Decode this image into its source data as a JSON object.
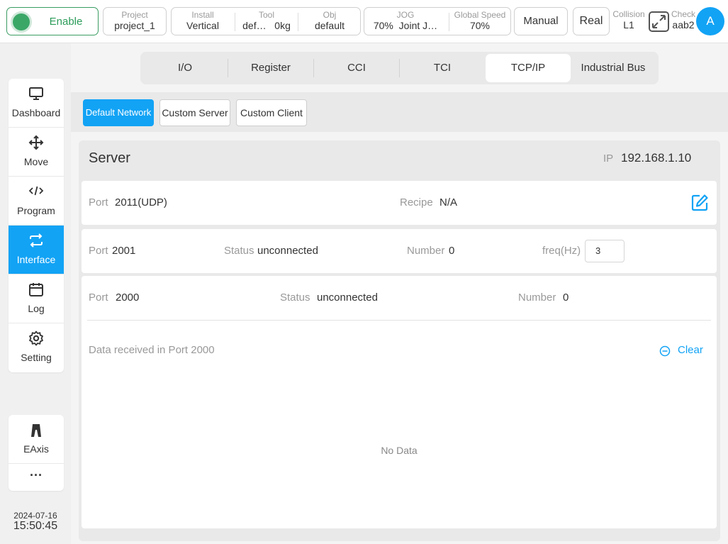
{
  "topbar": {
    "enable_label": "Enable",
    "project": {
      "caption": "Project",
      "value": "project_1"
    },
    "install": {
      "caption": "Install",
      "value": "Vertical"
    },
    "tool": {
      "caption": "Tool",
      "name": "def…",
      "weight": "0kg"
    },
    "obj": {
      "caption": "Obj",
      "value": "default"
    },
    "jog": {
      "caption": "JOG",
      "percent": "70%",
      "mode": "Joint J…"
    },
    "global_speed": {
      "caption": "Global Speed",
      "value": "70%"
    },
    "manual_label": "Manual",
    "real_label": "Real",
    "collision": {
      "caption": "Collision",
      "value": "L1"
    },
    "check": {
      "caption": "Check",
      "value": "aab2"
    },
    "avatar_letter": "A",
    "colors": {
      "accent": "#12a3f5",
      "enable_green": "#3aa767"
    }
  },
  "sidebar": {
    "items": [
      {
        "label": "Dashboard",
        "icon": "monitor-icon"
      },
      {
        "label": "Move",
        "icon": "move-arrows-icon"
      },
      {
        "label": "Program",
        "icon": "code-icon"
      },
      {
        "label": "Interface",
        "icon": "swap-icon",
        "active": true
      },
      {
        "label": "Log",
        "icon": "calendar-icon"
      },
      {
        "label": "Setting",
        "icon": "gear-icon"
      }
    ],
    "extra": {
      "label": "EAxis",
      "icon": "eaxis-icon"
    },
    "more": "···",
    "date": "2024-07-16",
    "time": "15:50:45"
  },
  "tabs": [
    "I/O",
    "Register",
    "CCI",
    "TCI",
    "TCP/IP",
    "Industrial Bus"
  ],
  "active_tab": "TCP/IP",
  "subtabs": [
    "Default Network",
    "Custom Server",
    "Custom Client"
  ],
  "active_subtab": "Default Network",
  "server": {
    "title": "Server",
    "ip_label": "IP",
    "ip_value": "192.168.1.10",
    "row1": {
      "port_label": "Port",
      "port_value": "2011(UDP)",
      "recipe_label": "Recipe",
      "recipe_value": "N/A"
    },
    "row2": {
      "port_label": "Port",
      "port_value": "2001",
      "status_label": "Status",
      "status_value": "unconnected",
      "number_label": "Number",
      "number_value": "0",
      "freq_label": "freq(Hz)",
      "freq_value": "3"
    },
    "row3": {
      "port_label": "Port",
      "port_value": "2000",
      "status_label": "Status",
      "status_value": "unconnected",
      "number_label": "Number",
      "number_value": "0"
    },
    "data_received_label": "Data received in Port 2000",
    "clear_label": "Clear",
    "no_data": "No Data"
  }
}
